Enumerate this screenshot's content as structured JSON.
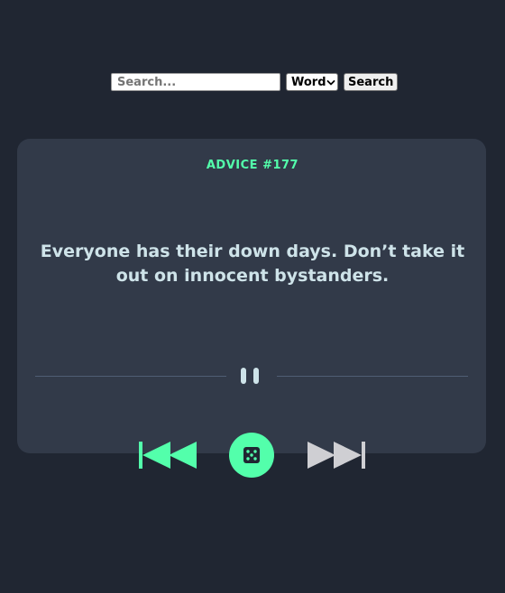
{
  "search": {
    "placeholder": "Search...",
    "value": "",
    "mode_selected": "Word",
    "button_label": "Search"
  },
  "advice": {
    "id_label": "ADVICE #177",
    "text": "Everyone has their down days. Don’t take it out on innocent bystanders."
  },
  "controls": {
    "prev_icon": "skip-previous-icon",
    "random_icon": "dice-icon",
    "next_icon": "skip-next-icon",
    "divider_icon": "pause-icon"
  },
  "colors": {
    "background": "#202632",
    "card": "#323a49",
    "accent": "#53ffab",
    "text": "#cee3e9",
    "divider": "#4f5d74",
    "next_control": "#cfcfd3"
  }
}
